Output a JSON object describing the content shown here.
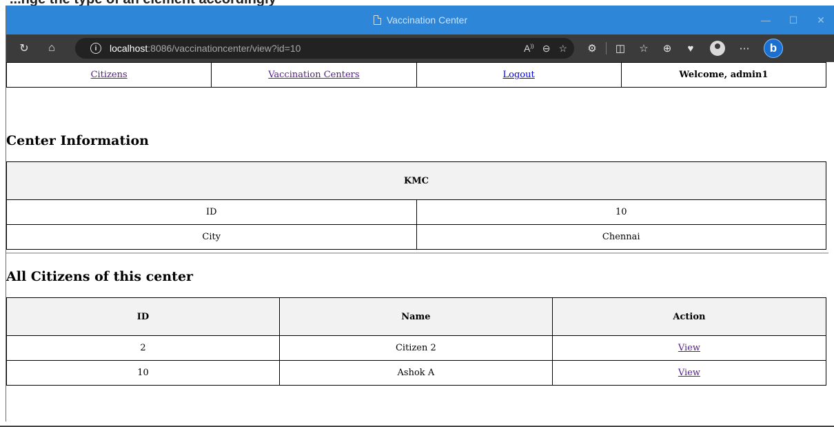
{
  "doc_heading_fragment": "...nge the type of an element accordingly",
  "browser": {
    "window_title": "Vaccination Center",
    "url_host": "localhost",
    "url_path": ":8086/vaccinationcenter/view?id=10"
  },
  "nav": {
    "citizens": "Citizens",
    "centers": "Vaccination Centers",
    "logout": "Logout",
    "welcome": "Welcome, admin1"
  },
  "center": {
    "heading": "Center Information",
    "name": "KMC",
    "rows": [
      {
        "label": "ID",
        "value": "10"
      },
      {
        "label": "City",
        "value": "Chennai"
      }
    ]
  },
  "citizens": {
    "heading": "All Citizens of this center",
    "columns": [
      "ID",
      "Name",
      "Action"
    ],
    "rows": [
      {
        "id": "2",
        "name": "Citizen 2",
        "action": "View"
      },
      {
        "id": "10",
        "name": "Ashok A",
        "action": "View"
      }
    ]
  }
}
